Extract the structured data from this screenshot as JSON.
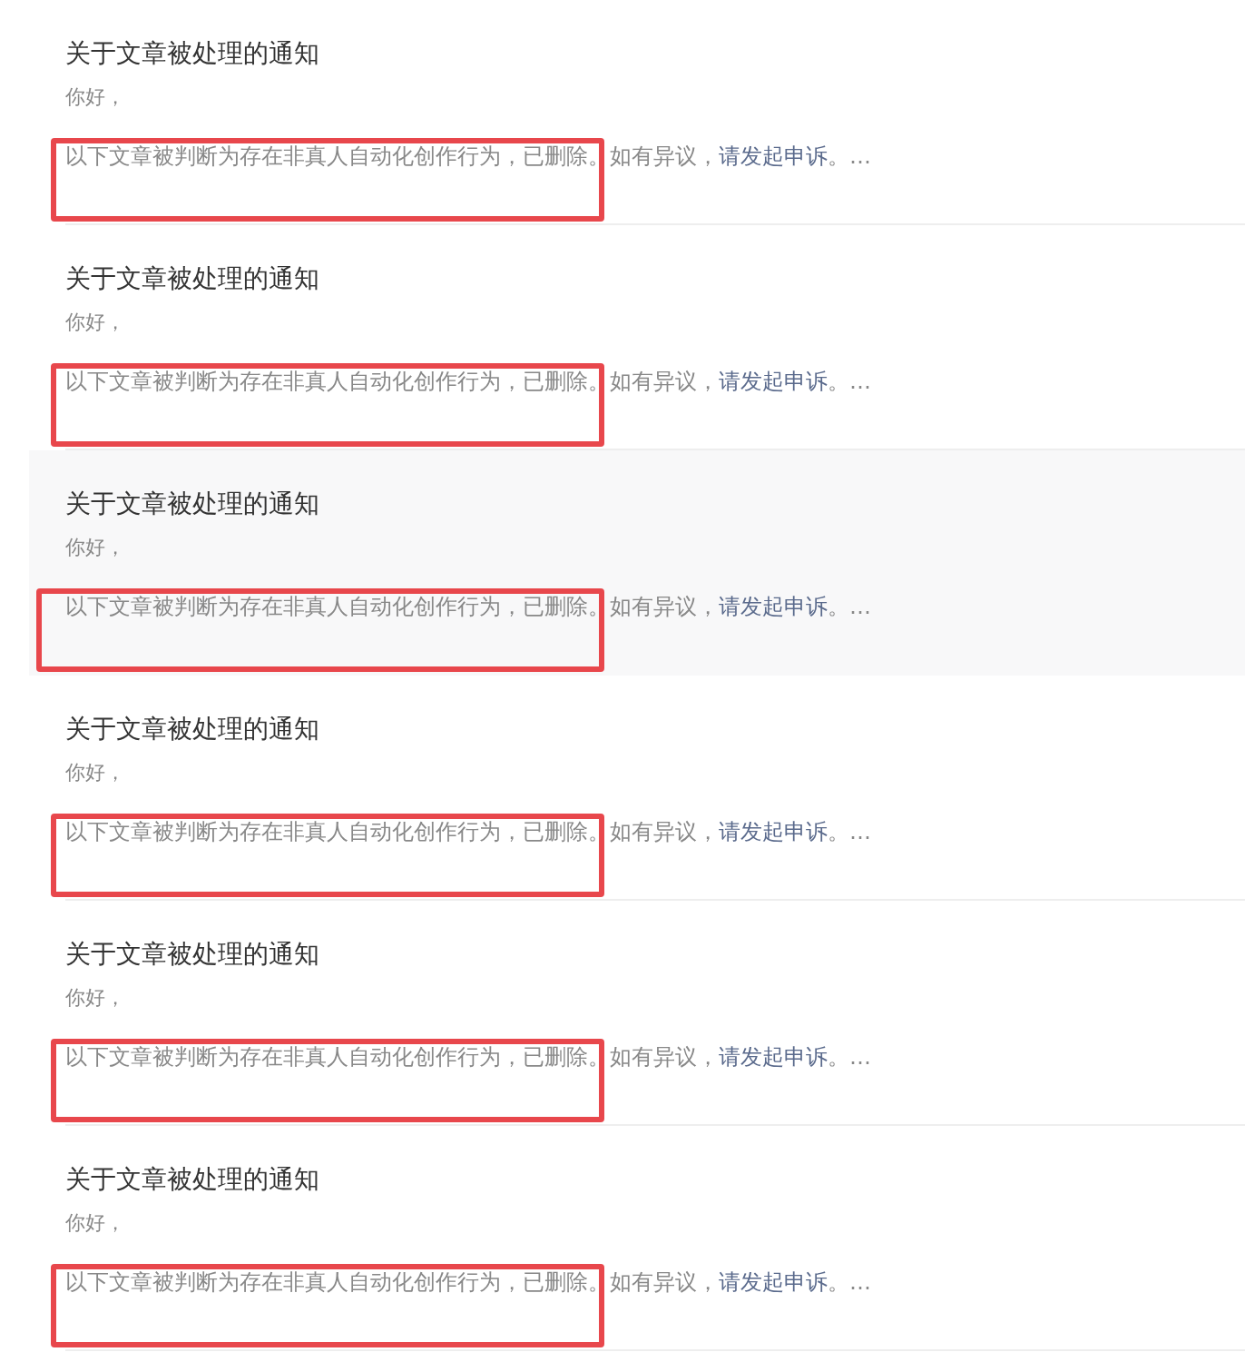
{
  "notifications": [
    {
      "title": "关于文章被处理的通知",
      "greeting": "你好，",
      "body": "以下文章被判断为存在非真人自动化创作行为，已删除。如有异议，",
      "link": "请发起申诉",
      "body_end": "。…",
      "hovered": false,
      "annotated": true
    },
    {
      "title": "关于文章被处理的通知",
      "greeting": "你好，",
      "body": "以下文章被判断为存在非真人自动化创作行为，已删除。如有异议，",
      "link": "请发起申诉",
      "body_end": "。…",
      "hovered": false,
      "annotated": true
    },
    {
      "title": "关于文章被处理的通知",
      "greeting": "你好，",
      "body": "以下文章被判断为存在非真人自动化创作行为，已删除。如有异议，",
      "link": "请发起申诉",
      "body_end": "。…",
      "hovered": true,
      "annotated": true
    },
    {
      "title": "关于文章被处理的通知",
      "greeting": "你好，",
      "body": "以下文章被判断为存在非真人自动化创作行为，已删除。如有异议，",
      "link": "请发起申诉",
      "body_end": "。…",
      "hovered": false,
      "annotated": true
    },
    {
      "title": "关于文章被处理的通知",
      "greeting": "你好，",
      "body": "以下文章被判断为存在非真人自动化创作行为，已删除。如有异议，",
      "link": "请发起申诉",
      "body_end": "。…",
      "hovered": false,
      "annotated": true
    },
    {
      "title": "关于文章被处理的通知",
      "greeting": "你好，",
      "body": "以下文章被判断为存在非真人自动化创作行为，已删除。如有异议，",
      "link": "请发起申诉",
      "body_end": "。…",
      "hovered": false,
      "annotated": true
    }
  ]
}
